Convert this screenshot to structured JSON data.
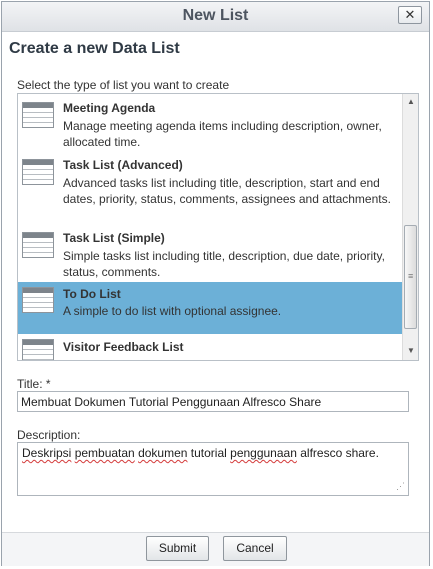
{
  "dialog": {
    "title": "New List",
    "close_label": "✕",
    "heading": "Create a new Data List"
  },
  "list_type": {
    "label": "Select the type of list you want to create",
    "items": [
      {
        "title": "Meeting Agenda",
        "description": "Manage meeting agenda items including description, owner, allocated time.",
        "selected": false
      },
      {
        "title": "Task List (Advanced)",
        "description": "Advanced tasks list including title, description, start and end dates, priority, status, comments, assignees and attachments.",
        "selected": false
      },
      {
        "title": "Task List (Simple)",
        "description": "Simple tasks list including title, description, due date, priority, status, comments.",
        "selected": false
      },
      {
        "title": "To Do List",
        "description": "A simple to do list with optional assignee.",
        "selected": true
      },
      {
        "title": "Visitor Feedback List",
        "description": "",
        "selected": false
      }
    ]
  },
  "form": {
    "title_label": "Title: *",
    "title_value": "Membuat Dokumen Tutorial Penggunaan Alfresco Share",
    "description_label": "Description:",
    "description_parts": [
      "Deskripsi",
      " ",
      "pembuatan",
      " ",
      "dokumen",
      " tutorial ",
      "penggunaan",
      " alfresco share."
    ]
  },
  "footer": {
    "submit_label": "Submit",
    "cancel_label": "Cancel"
  }
}
